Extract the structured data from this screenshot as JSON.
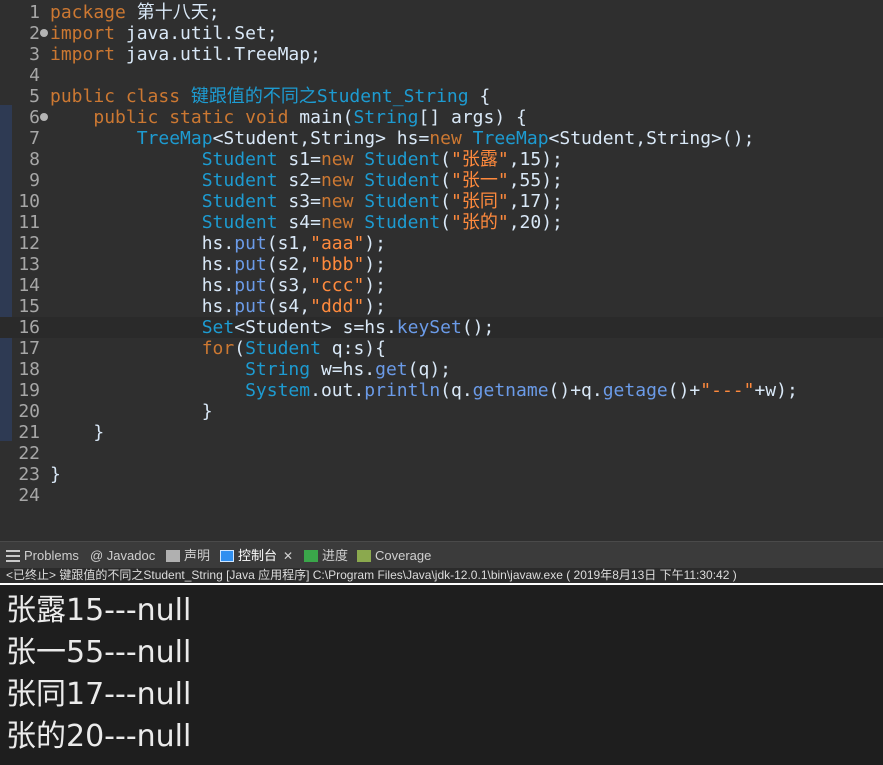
{
  "editor": {
    "lines": [
      {
        "n": "1",
        "segs": [
          [
            "kw",
            "package "
          ],
          [
            "plain",
            "第十八天;"
          ]
        ]
      },
      {
        "n": "2",
        "segs": [
          [
            "kw",
            "import "
          ],
          [
            "plain",
            "java.util.Set;"
          ]
        ]
      },
      {
        "n": "3",
        "segs": [
          [
            "kw",
            "import "
          ],
          [
            "plain",
            "java.util.TreeMap;"
          ]
        ]
      },
      {
        "n": "4",
        "segs": []
      },
      {
        "n": "5",
        "segs": [
          [
            "kw",
            "public class "
          ],
          [
            "cls",
            "键跟值的不同之Student_String"
          ],
          [
            "plain",
            " {"
          ]
        ]
      },
      {
        "n": "6",
        "segs": [
          [
            "plain",
            "    "
          ],
          [
            "kw",
            "public static void "
          ],
          [
            "plain",
            "main("
          ],
          [
            "type",
            "String"
          ],
          [
            "plain",
            "[] args) {"
          ]
        ]
      },
      {
        "n": "7",
        "segs": [
          [
            "plain",
            "        "
          ],
          [
            "type",
            "TreeMap"
          ],
          [
            "plain",
            "<Student,String> hs="
          ],
          [
            "kw",
            "new "
          ],
          [
            "type",
            "TreeMap"
          ],
          [
            "plain",
            "<Student,String>();"
          ]
        ]
      },
      {
        "n": "8",
        "segs": [
          [
            "plain",
            "              "
          ],
          [
            "type",
            "Student "
          ],
          [
            "plain",
            "s1="
          ],
          [
            "kw",
            "new "
          ],
          [
            "type",
            "Student"
          ],
          [
            "plain",
            "("
          ],
          [
            "str",
            "\"张露\""
          ],
          [
            "plain",
            ",15);"
          ]
        ]
      },
      {
        "n": "9",
        "segs": [
          [
            "plain",
            "              "
          ],
          [
            "type",
            "Student "
          ],
          [
            "plain",
            "s2="
          ],
          [
            "kw",
            "new "
          ],
          [
            "type",
            "Student"
          ],
          [
            "plain",
            "("
          ],
          [
            "str",
            "\"张一\""
          ],
          [
            "plain",
            ",55);"
          ]
        ]
      },
      {
        "n": "10",
        "segs": [
          [
            "plain",
            "              "
          ],
          [
            "type",
            "Student "
          ],
          [
            "plain",
            "s3="
          ],
          [
            "kw",
            "new "
          ],
          [
            "type",
            "Student"
          ],
          [
            "plain",
            "("
          ],
          [
            "str",
            "\"张同\""
          ],
          [
            "plain",
            ",17);"
          ]
        ]
      },
      {
        "n": "11",
        "segs": [
          [
            "plain",
            "              "
          ],
          [
            "type",
            "Student "
          ],
          [
            "plain",
            "s4="
          ],
          [
            "kw",
            "new "
          ],
          [
            "type",
            "Student"
          ],
          [
            "plain",
            "("
          ],
          [
            "str",
            "\"张的\""
          ],
          [
            "plain",
            ",20);"
          ]
        ]
      },
      {
        "n": "12",
        "segs": [
          [
            "plain",
            "              hs."
          ],
          [
            "method",
            "put"
          ],
          [
            "plain",
            "(s1,"
          ],
          [
            "str",
            "\"aaa\""
          ],
          [
            "plain",
            ");"
          ]
        ]
      },
      {
        "n": "13",
        "segs": [
          [
            "plain",
            "              hs."
          ],
          [
            "method",
            "put"
          ],
          [
            "plain",
            "(s2,"
          ],
          [
            "str",
            "\"bbb\""
          ],
          [
            "plain",
            ");"
          ]
        ]
      },
      {
        "n": "14",
        "segs": [
          [
            "plain",
            "              hs."
          ],
          [
            "method",
            "put"
          ],
          [
            "plain",
            "(s3,"
          ],
          [
            "str",
            "\"ccc\""
          ],
          [
            "plain",
            ");"
          ]
        ]
      },
      {
        "n": "15",
        "segs": [
          [
            "plain",
            "              hs."
          ],
          [
            "method",
            "put"
          ],
          [
            "plain",
            "(s4,"
          ],
          [
            "str",
            "\"ddd\""
          ],
          [
            "plain",
            ");"
          ]
        ]
      },
      {
        "n": "16",
        "segs": [
          [
            "plain",
            "              "
          ],
          [
            "type",
            "Set"
          ],
          [
            "plain",
            "<Student> s=hs."
          ],
          [
            "method",
            "keySet"
          ],
          [
            "plain",
            "();"
          ]
        ]
      },
      {
        "n": "17",
        "segs": [
          [
            "plain",
            "              "
          ],
          [
            "kw",
            "for"
          ],
          [
            "plain",
            "("
          ],
          [
            "type",
            "Student "
          ],
          [
            "plain",
            "q:s){"
          ]
        ]
      },
      {
        "n": "18",
        "segs": [
          [
            "plain",
            "                  "
          ],
          [
            "type",
            "String "
          ],
          [
            "plain",
            "w=hs."
          ],
          [
            "method",
            "get"
          ],
          [
            "plain",
            "(q);"
          ]
        ]
      },
      {
        "n": "19",
        "segs": [
          [
            "plain",
            "                  "
          ],
          [
            "type",
            "System"
          ],
          [
            "plain",
            ".out."
          ],
          [
            "method",
            "println"
          ],
          [
            "plain",
            "(q."
          ],
          [
            "method",
            "getname"
          ],
          [
            "plain",
            "()+q."
          ],
          [
            "method",
            "getage"
          ],
          [
            "plain",
            "()+"
          ],
          [
            "str",
            "\"---\""
          ],
          [
            "plain",
            "+w);"
          ]
        ]
      },
      {
        "n": "20",
        "segs": [
          [
            "plain",
            "              }"
          ]
        ]
      },
      {
        "n": "21",
        "segs": [
          [
            "plain",
            "    }"
          ]
        ]
      },
      {
        "n": "22",
        "segs": []
      },
      {
        "n": "23",
        "segs": [
          [
            "plain",
            "}"
          ]
        ]
      },
      {
        "n": "24",
        "segs": []
      }
    ]
  },
  "tabs": [
    {
      "label": "Problems",
      "icon": "problems-icon",
      "color": "#c8c8c8"
    },
    {
      "label": "@ Javadoc",
      "icon": "javadoc-icon",
      "color": "#c8c8c8"
    },
    {
      "label": "声明",
      "icon": "declaration-icon",
      "color": "#c8c8c8"
    },
    {
      "label": "控制台",
      "icon": "console-icon",
      "color": "#4fa3ff",
      "active": true
    },
    {
      "label": "进度",
      "icon": "progress-icon",
      "color": "#4caf50"
    },
    {
      "label": "Coverage",
      "icon": "coverage-icon",
      "color": "#9cbc5a"
    }
  ],
  "status": "<已终止> 键跟值的不同之Student_String [Java 应用程序] C:\\Program Files\\Java\\jdk-12.0.1\\bin\\javaw.exe ( 2019年8月13日 下午11:30:42 )",
  "console_lines": [
    "张露15---null",
    "张一55---null",
    "张同17---null",
    "张的20---null"
  ]
}
